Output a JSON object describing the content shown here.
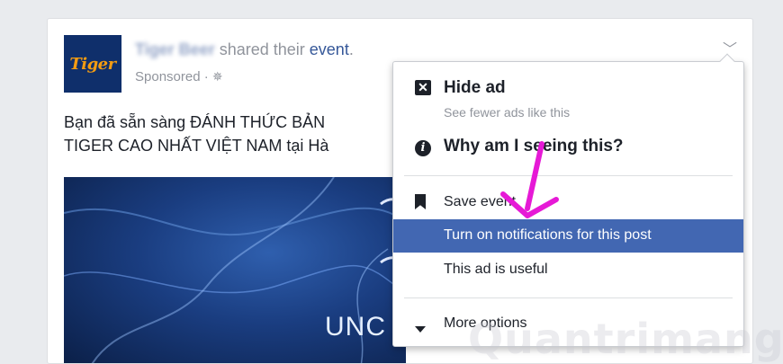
{
  "post": {
    "logo_text": "Tiger",
    "author": "Tiger Beer",
    "action_text": " shared their ",
    "object_link": "event",
    "object_suffix": ".",
    "sponsored": "Sponsored · ",
    "body_line1": "Bạn đã sẵn sàng ĐÁNH THỨC BẢN",
    "body_line2": "TIGER CAO NHẤT VIỆT NAM tại Hà",
    "media_text": "UNC"
  },
  "menu": {
    "hide_ad_title": "Hide ad",
    "hide_ad_sub": "See fewer ads like this",
    "why_title": "Why am I seeing this?",
    "save_event": "Save event",
    "notifications": "Turn on notifications for this post",
    "useful": "This ad is useful",
    "more_options": "More options"
  },
  "colors": {
    "highlight": "#4267b2",
    "annotation_arrow": "#e619d6"
  },
  "icons": {
    "chevron": "chevron-down-icon",
    "hide": "close-box-icon",
    "why": "info-icon",
    "save": "bookmark-icon",
    "more": "caret-down-icon"
  },
  "watermark": "Quantrimang"
}
